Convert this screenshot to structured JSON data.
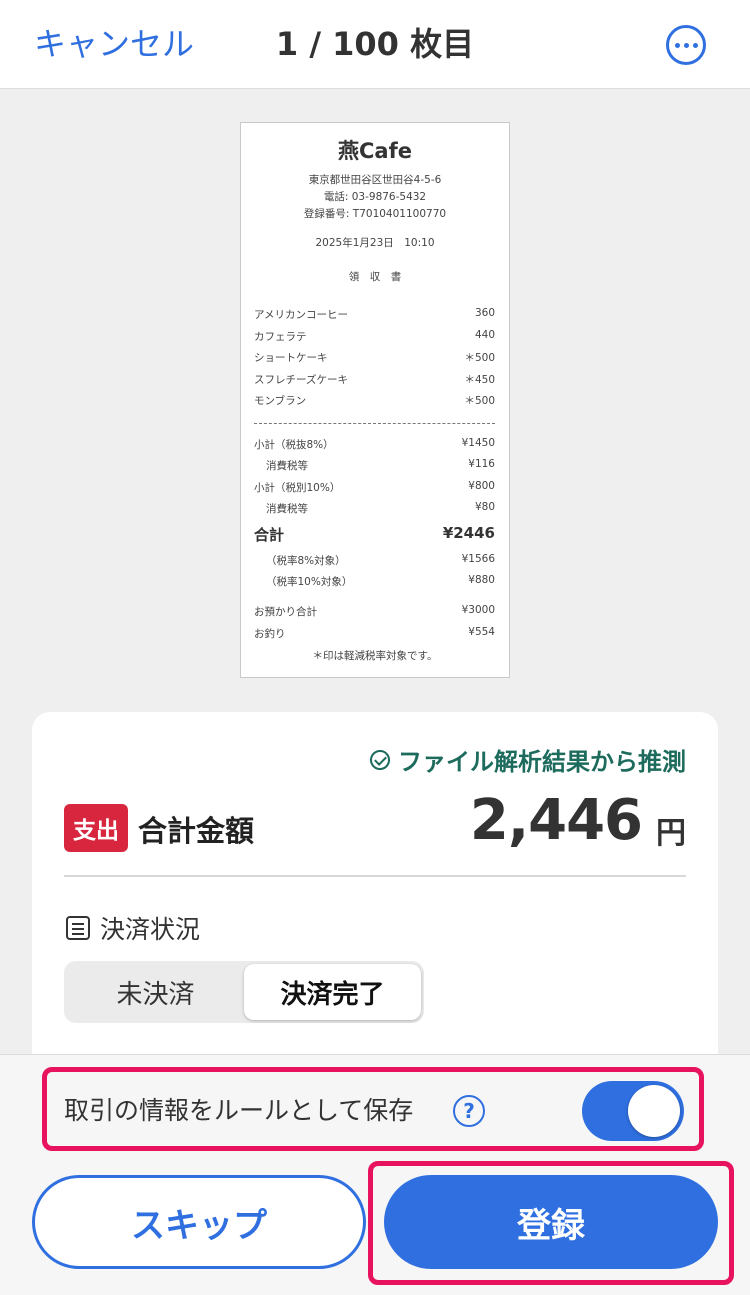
{
  "header": {
    "cancel_label": "キャンセル",
    "title": "1 / 100 枚目"
  },
  "receipt": {
    "shop": "燕Cafe",
    "address": "東京都世田谷区世田谷4-5-6",
    "phone": "電話: 03-9876-5432",
    "reg_no": "登録番号: T7010401100770",
    "datetime": "2025年1月23日　10:10",
    "doc_title": "領　収　書",
    "items": [
      {
        "name": "アメリカンコーヒー",
        "price": "360"
      },
      {
        "name": "カフェラテ",
        "price": "440"
      },
      {
        "name": "ショートケーキ",
        "price": "＊500"
      },
      {
        "name": "スフレチーズケーキ",
        "price": "＊450"
      },
      {
        "name": "モンブラン",
        "price": "＊500"
      }
    ],
    "summary": [
      {
        "name": "小計（税抜8%）",
        "price": "¥1450"
      },
      {
        "name": "消費税等",
        "price": "¥116"
      },
      {
        "name": "小計（税別10%）",
        "price": "¥800"
      },
      {
        "name": "消費税等",
        "price": "¥80"
      }
    ],
    "total_label": "合計",
    "total_value": "¥2446",
    "breakdown": [
      {
        "name": "（税率8%対象）",
        "price": "¥1566"
      },
      {
        "name": "（税率10%対象）",
        "price": "¥880"
      }
    ],
    "payment": [
      {
        "name": "お預かり合計",
        "price": "¥3000"
      },
      {
        "name": "お釣り",
        "price": "¥554"
      }
    ],
    "footnote": "＊印は軽減税率対象です。"
  },
  "card": {
    "inferred_text": "ファイル解析結果から推測",
    "badge": "支出",
    "total_label": "合計金額",
    "amount": "2,446",
    "currency": "円",
    "status_label": "決済状況",
    "segment_options": [
      "未決済",
      "決済完了"
    ],
    "segment_selected": "決済完了"
  },
  "bottom": {
    "rule_label": "取引の情報をルールとして保存",
    "help_symbol": "?",
    "rule_toggle_on": true,
    "skip_label": "スキップ",
    "register_label": "登録"
  },
  "colors": {
    "accent": "#2f6fe0",
    "expense_badge": "#d7263d",
    "inferred_text": "#1d6b5c",
    "highlight_box": "#e8135e"
  }
}
